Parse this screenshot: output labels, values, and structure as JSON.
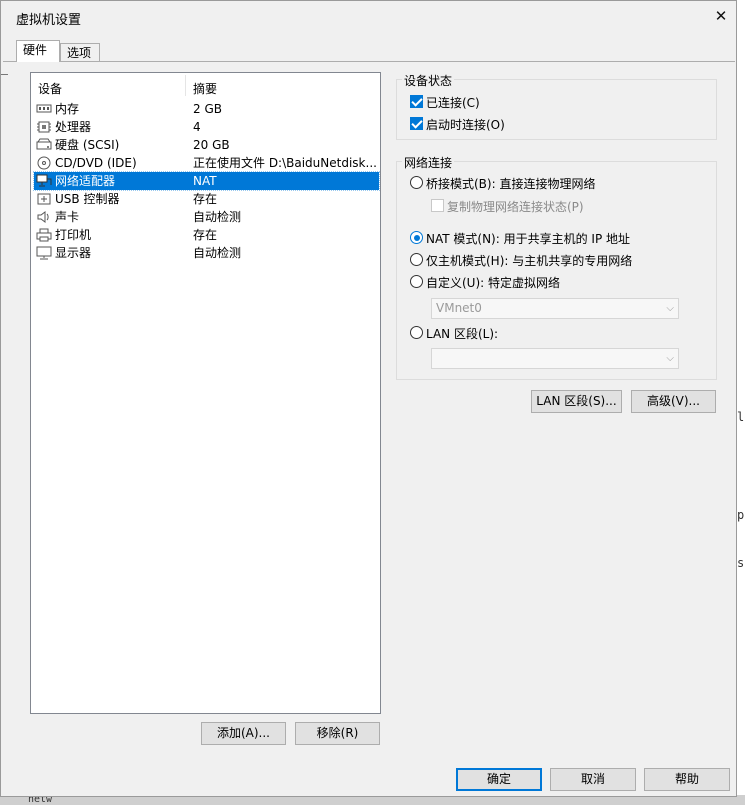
{
  "window": {
    "title": "虚拟机设置",
    "close_glyph": "✕"
  },
  "tabs": [
    {
      "label": "硬件"
    },
    {
      "label": "选项"
    }
  ],
  "device_list": {
    "col_device": "设备",
    "col_summary": "摘要",
    "rows": [
      {
        "name": "内存",
        "summary": "2 GB",
        "icon": "memory-icon"
      },
      {
        "name": "处理器",
        "summary": "4",
        "icon": "processor-icon"
      },
      {
        "name": "硬盘 (SCSI)",
        "summary": "20 GB",
        "icon": "hard-disk-icon"
      },
      {
        "name": "CD/DVD (IDE)",
        "summary": "正在使用文件 D:\\BaiduNetdisk...",
        "icon": "cd-dvd-icon"
      },
      {
        "name": "网络适配器",
        "summary": "NAT",
        "icon": "network-adapter-icon",
        "selected": true
      },
      {
        "name": "USB 控制器",
        "summary": "存在",
        "icon": "usb-icon"
      },
      {
        "name": "声卡",
        "summary": "自动检测",
        "icon": "sound-icon"
      },
      {
        "name": "打印机",
        "summary": "存在",
        "icon": "printer-icon"
      },
      {
        "name": "显示器",
        "summary": "自动检测",
        "icon": "monitor-icon"
      }
    ]
  },
  "list_buttons": {
    "add": "添加(A)...",
    "remove": "移除(R)"
  },
  "device_status": {
    "title": "设备状态",
    "connected": "已连接(C)",
    "connect_at_power_on": "启动时连接(O)"
  },
  "network_connection": {
    "title": "网络连接",
    "bridged": "桥接模式(B): 直接连接物理网络",
    "replicate": "复制物理网络连接状态(P)",
    "nat": "NAT 模式(N): 用于共享主机的 IP 地址",
    "host_only": "仅主机模式(H): 与主机共享的专用网络",
    "custom": "自定义(U): 特定虚拟网络",
    "custom_value": "VMnet0",
    "lan_segment": "LAN 区段(L):",
    "lan_segment_value": ""
  },
  "adapter_buttons": {
    "lan_segments": "LAN 区段(S)...",
    "advanced": "高级(V)..."
  },
  "footer_buttons": {
    "ok": "确定",
    "cancel": "取消",
    "help": "帮助"
  },
  "background": {
    "fragment_1": "ld",
    "fragment_2": "p",
    "fragment_3": "si",
    "fragment_4": "netw"
  },
  "colors": {
    "selection": "#0078d7",
    "accent": "#0078d7"
  }
}
